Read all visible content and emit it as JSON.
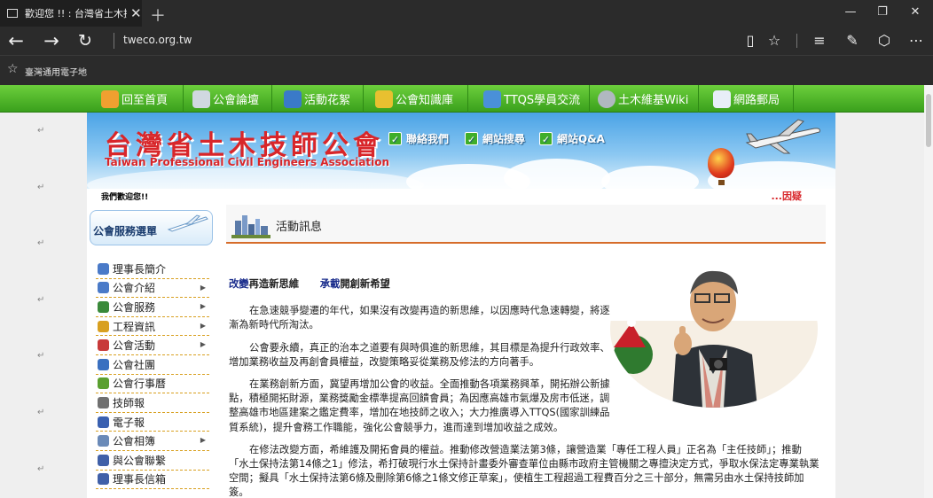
{
  "browser": {
    "tab_title": "歡迎您 !! : 台灣省土木技",
    "address": "tweco.org.tw",
    "favorite": "臺灣通用電子地"
  },
  "nav": [
    {
      "label": "回至首頁",
      "color": "#f0a030"
    },
    {
      "label": "公會論壇",
      "color": "#d0d8e0"
    },
    {
      "label": "活動花絮",
      "color": "#3a7ac8"
    },
    {
      "label": "公會知識庫",
      "color": "#e8c030"
    },
    {
      "label": "TTQS學員交流",
      "color": "#4a90d8"
    },
    {
      "label": "土木維基Wiki",
      "color": "#b0b8c0"
    },
    {
      "label": "網路郵局",
      "color": "#e8eef8"
    }
  ],
  "banner": {
    "title": "台灣省土木技師公會",
    "subtitle": "Taiwan Professional Civil Engineers Association",
    "links": [
      "聯絡我們",
      "網站搜尋",
      "網站Q&A"
    ]
  },
  "welcome": "我們歡迎您!!",
  "ticker": "...因疑",
  "sidebar": {
    "title": "公會服務選單",
    "items": [
      {
        "label": "理事長簡介",
        "icon": "#4a7ac8",
        "arrow": false
      },
      {
        "label": "公會介紹",
        "icon": "#4a7ac8",
        "arrow": true
      },
      {
        "label": "公會服務",
        "icon": "#3a8a3a",
        "arrow": true
      },
      {
        "label": "工程資訊",
        "icon": "#d8a020",
        "arrow": true
      },
      {
        "label": "公會活動",
        "icon": "#c83a3a",
        "arrow": true
      },
      {
        "label": "公會社團",
        "icon": "#3a70c0",
        "arrow": false
      },
      {
        "label": "公會行事曆",
        "icon": "#5aa030",
        "arrow": false
      },
      {
        "label": "技師報",
        "icon": "#707070",
        "arrow": false
      },
      {
        "label": "電子報",
        "icon": "#3a60b0",
        "arrow": false
      },
      {
        "label": "公會相簿",
        "icon": "#6a8ab8",
        "arrow": true
      },
      {
        "label": "與公會聯繫",
        "icon": "#4060a8",
        "arrow": false
      },
      {
        "label": "理事長信箱",
        "icon": "#4060a8",
        "arrow": false
      }
    ]
  },
  "content": {
    "heading": "活動訊息",
    "lead_a_blue": "改變",
    "lead_a": "再造新思維",
    "lead_b_blue": "承載",
    "lead_b": "開創新希望",
    "paragraphs": [
      "在急速競爭變遷的年代，如果沒有改變再造的新思維，以因應時代急速轉變，將逐漸為新時代所淘汰。",
      "公會要永續，真正的治本之道要有與時俱進的新思維，其目標是為提升行政效率、增加業務收益及再創會員權益，改變策略妥從業務及修法的方向著手。",
      "在業務創新方面，冀望再增加公會的收益。全面推動各項業務興革，開拓辦公新據點，積極開拓財源，業務獎勵金標準提高回饋會員；為因應高雄市氣爆及房市低迷，調整高雄市地區建案之鑑定費率，增加在地技師之收入；大力推廣導入TTQS(國家訓練品質系統)，提升會務工作職能，強化公會競爭力，進而達到增加收益之成效。",
      "在修法改變方面，希維護及開拓會員的權益。推動修改營造業法第3條，讓營造業「專任工程人員」正名為「主任技師」；推動「水土保持法第14條之1」修法，希打破現行水土保持計畫委外審查單位由縣市政府主管機關之專擅決定方式，爭取水保法定專業執業空間；擬具「水土保持法第6條及刪除第6條之1條文修正草案」，使植生工程超過工程費百分之三十部分，無需另由水土保持技師加簽。"
    ]
  }
}
